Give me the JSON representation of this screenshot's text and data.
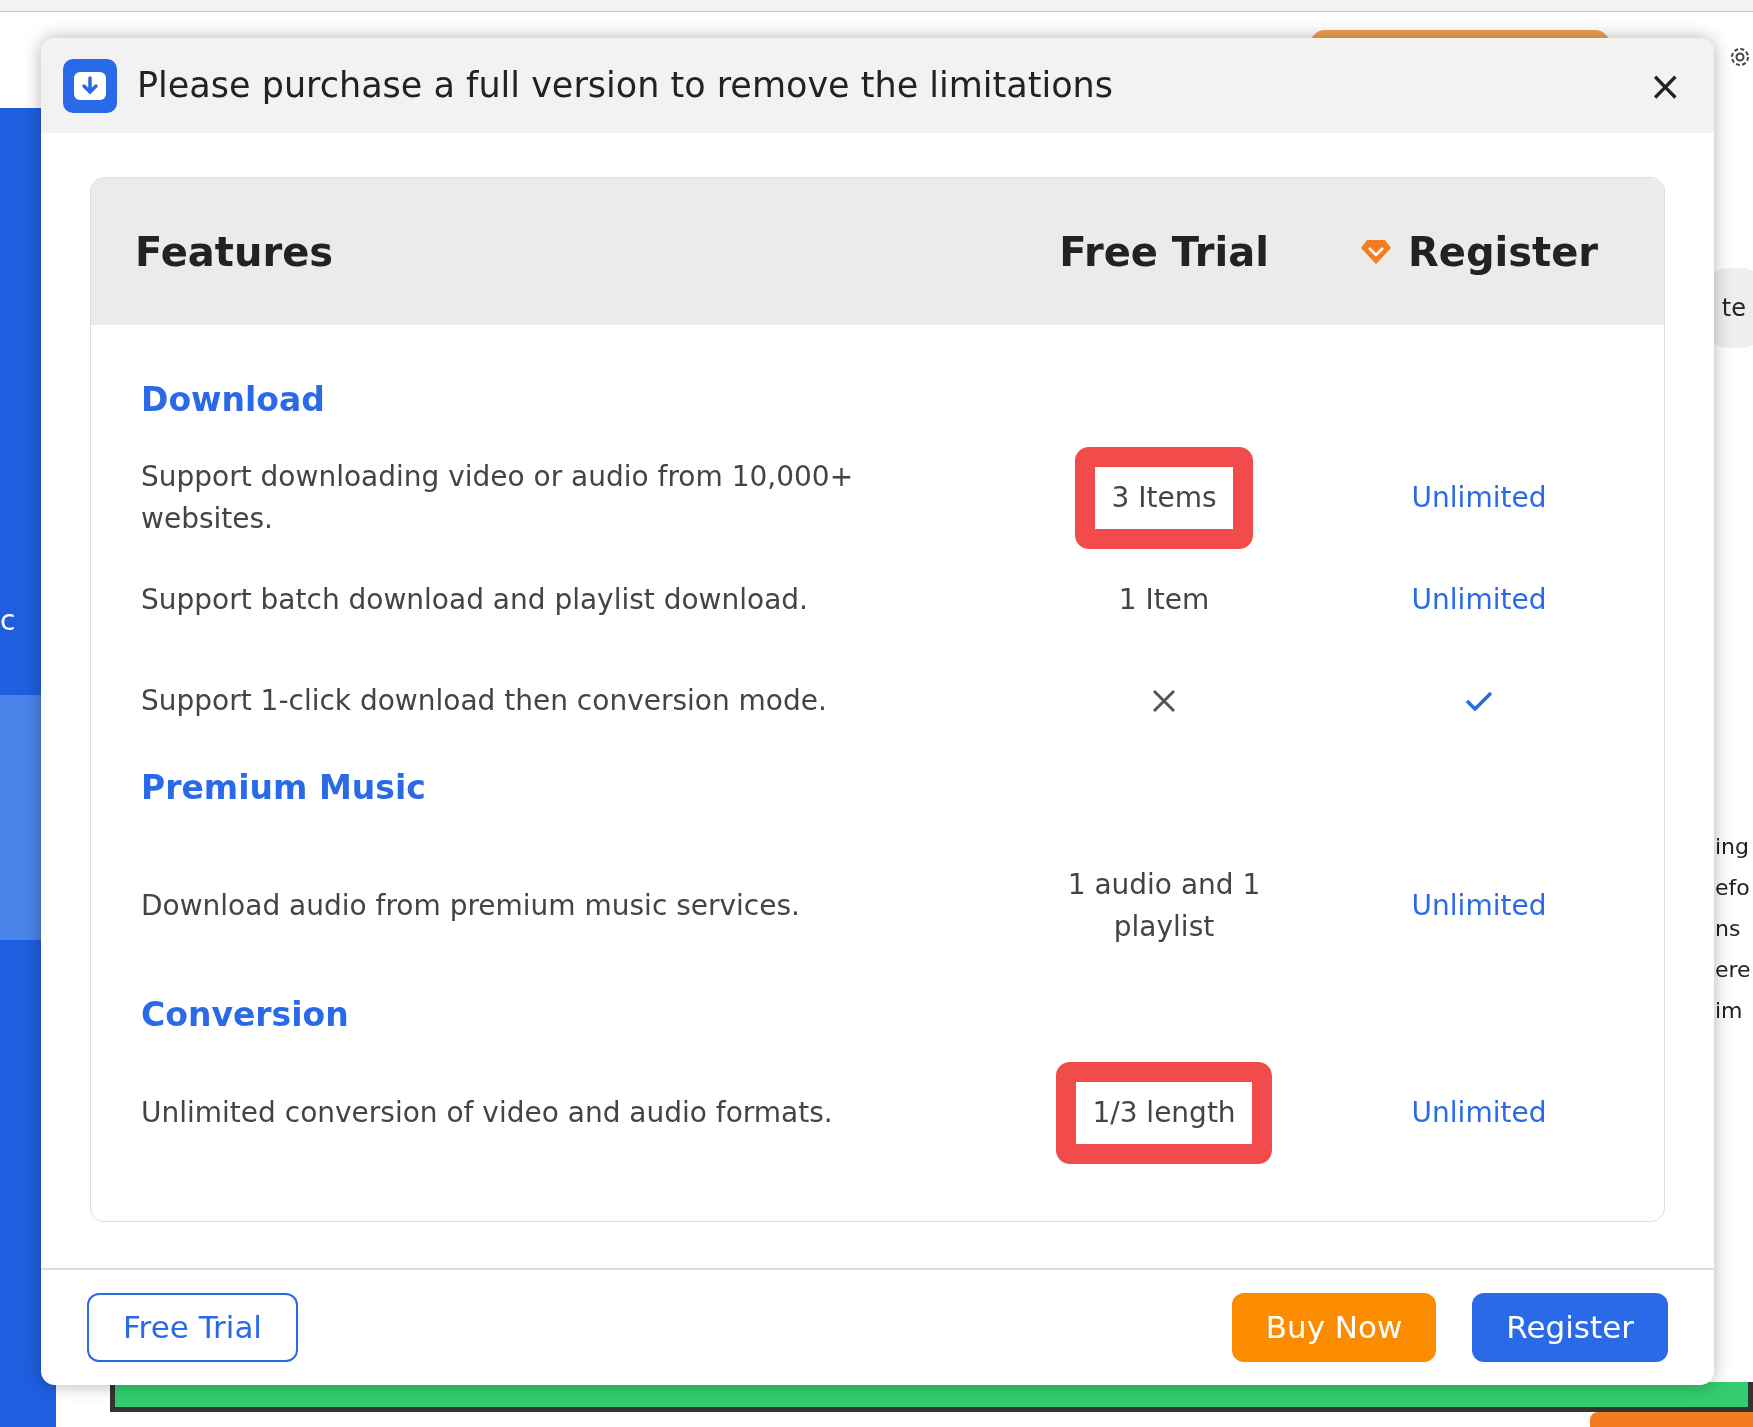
{
  "background": {
    "sidebar_letter": "c",
    "pill_text": "te",
    "fragments": [
      "ing",
      "efo",
      "ns",
      "ere",
      "im"
    ]
  },
  "dialog": {
    "title": "Please purchase a full version to remove the limitations",
    "close": "×"
  },
  "table": {
    "columns": [
      "Features",
      "Free Trial",
      "Register"
    ],
    "sections": [
      {
        "title": "Download",
        "rows": [
          {
            "feature": "Support downloading video or audio from 10,000+ websites.",
            "trial": {
              "kind": "text",
              "text": "3 Items",
              "highlighted": true
            },
            "register": {
              "kind": "text",
              "text": "Unlimited"
            }
          },
          {
            "feature": "Support batch download and playlist download.",
            "trial": {
              "kind": "text",
              "text": "1 Item",
              "highlighted": false
            },
            "register": {
              "kind": "text",
              "text": "Unlimited"
            }
          },
          {
            "feature": "Support 1-click download then conversion mode.",
            "trial": {
              "kind": "cross"
            },
            "register": {
              "kind": "check"
            }
          }
        ]
      },
      {
        "title": "Premium Music",
        "rows": [
          {
            "feature": "Download audio from premium music services.",
            "trial": {
              "kind": "text",
              "text": "1 audio and 1 playlist",
              "highlighted": false
            },
            "register": {
              "kind": "text",
              "text": "Unlimited"
            }
          }
        ]
      },
      {
        "title": "Conversion",
        "rows": [
          {
            "feature": "Unlimited conversion of video and audio formats.",
            "trial": {
              "kind": "text",
              "text": "1/3 length",
              "highlighted": true
            },
            "register": {
              "kind": "text",
              "text": "Unlimited"
            }
          }
        ]
      }
    ]
  },
  "buttons": [
    {
      "kind": "outline",
      "label": "Free Trial"
    },
    {
      "kind": "orange",
      "label": "Buy Now"
    },
    {
      "kind": "primary",
      "label": "Register"
    }
  ]
}
